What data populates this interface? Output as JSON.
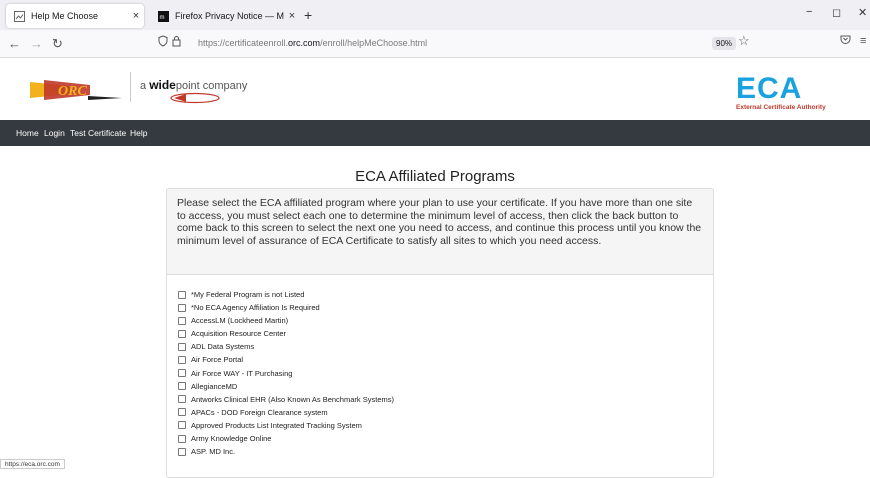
{
  "browser": {
    "tabs": [
      {
        "title": "Help Me Choose",
        "close": "×"
      },
      {
        "title": "Firefox Privacy Notice — Mozill",
        "close": "×"
      }
    ],
    "new_tab": "+",
    "window_controls": {
      "minimize": "−",
      "maximize": "◻",
      "close": "✕"
    },
    "nav": {
      "back": "←",
      "forward": "→",
      "reload": "↻"
    },
    "url": {
      "prefix": "https://certificateenroll.",
      "domain": "orc.com",
      "path": "/enroll/helpMeChoose.html"
    },
    "zoom": "90%",
    "status_url": "https://eca.orc.com"
  },
  "brand": {
    "orc_logo_text": "ORC",
    "tagline_prefix": "a ",
    "tagline_bold": "wide",
    "tagline_rest": "point company",
    "eca_logo": "ECA",
    "eca_subtitle": "External Certificate Authority",
    "colors": {
      "eca_blue": "#1aa1e0",
      "eca_red": "#c0392b",
      "orc_red": "#c0392b",
      "orc_gold": "#f2b21b",
      "nav_bg": "#343a40"
    }
  },
  "sitenav": {
    "items": [
      "Home",
      "Login",
      "Test Certificate",
      "Help"
    ]
  },
  "main": {
    "title": "ECA Affiliated Programs",
    "instructions": "Please select the ECA affiliated program where your plan to use your certificate. If you have more than one site to access, you must select each one to determine the minimum level of access, then click the back button to come back to this screen to select the next one you need to access, and continue this process until you know the minimum level of assurance of ECA Certificate to satisfy all sites to which you need access.",
    "programs": [
      "*My Federal Program is not Listed",
      "*No ECA Agency Affiliation Is Required",
      "AccessLM (Lockheed Martin)",
      "Acquisition Resource Center",
      "ADL Data Systems",
      "Air Force Portal",
      "Air Force WAY - IT Purchasing",
      "AllegianceMD",
      "Antworks Clinical EHR (Also Known As Benchmark Systems)",
      "APACs - DOD Foreign Clearance system",
      "Approved Products List Integrated Tracking System",
      "Army Knowledge Online",
      "ASP. MD Inc."
    ]
  }
}
